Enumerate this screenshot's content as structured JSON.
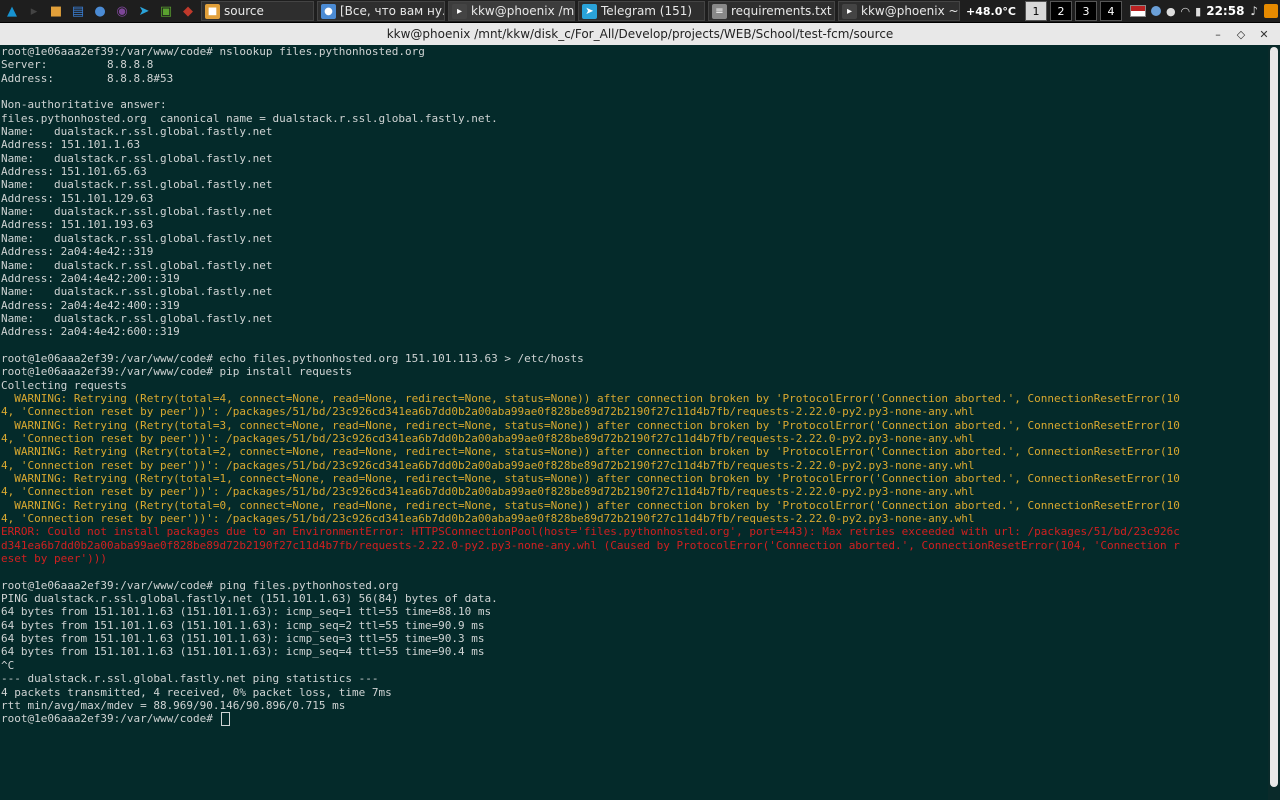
{
  "panel": {
    "launchers": [
      {
        "icon": "arch-logo-icon",
        "color": "#1793d1"
      },
      {
        "icon": "terminal-icon",
        "color": "#444"
      },
      {
        "icon": "folder-icon",
        "color": "#e2a03a"
      },
      {
        "icon": "files-icon",
        "color": "#3a7fd5"
      },
      {
        "icon": "chromium-icon",
        "color": "#4b8bd4"
      },
      {
        "icon": "tor-icon",
        "color": "#7d4698"
      },
      {
        "icon": "telegram-icon",
        "color": "#2aa3d9"
      },
      {
        "icon": "screenshot-icon",
        "color": "#5aa12f"
      },
      {
        "icon": "app-icon",
        "color": "#c0392b"
      }
    ],
    "tasks": [
      {
        "label": "source",
        "icon": "folder-icon",
        "color": "#e2a03a"
      },
      {
        "label": "[Все, что вам ну...",
        "icon": "chromium-icon",
        "color": "#4b8bd4"
      },
      {
        "label": "kkw@phoenix /m...",
        "icon": "terminal-icon",
        "color": "#444",
        "active": true
      },
      {
        "label": "Telegram (151)",
        "icon": "telegram-icon",
        "color": "#2aa3d9"
      },
      {
        "label": "requirements.txt ...",
        "icon": "text-editor-icon",
        "color": "#888"
      },
      {
        "label": "kkw@phoenix ~",
        "icon": "terminal-icon",
        "color": "#444"
      }
    ],
    "temperature": "+48.0°C",
    "workspaces": [
      "1",
      "2",
      "3",
      "4"
    ],
    "current_workspace": "1",
    "tray_icons": [
      "us-flag-icon",
      "chromium-tray-icon",
      "user-icon",
      "wifi-icon",
      "battery-icon"
    ],
    "clock": "22:58",
    "extra_icons": [
      "music-icon",
      "app-menu-icon"
    ]
  },
  "window": {
    "title": "kkw@phoenix /mnt/kkw/disk_c/For_All/Develop/projects/WEB/School/test-fcm/source",
    "buttons": {
      "minimize": "–",
      "maximize": "◇",
      "close": "✕"
    }
  },
  "terminal": {
    "lines": [
      {
        "t": "root@1e06aaa2ef39:/var/www/code# nslookup files.pythonhosted.org",
        "c": "n"
      },
      {
        "t": "Server:         8.8.8.8",
        "c": "n"
      },
      {
        "t": "Address:        8.8.8.8#53",
        "c": "n"
      },
      {
        "t": "",
        "c": "n"
      },
      {
        "t": "Non-authoritative answer:",
        "c": "n"
      },
      {
        "t": "files.pythonhosted.org  canonical name = dualstack.r.ssl.global.fastly.net.",
        "c": "n"
      },
      {
        "t": "Name:   dualstack.r.ssl.global.fastly.net",
        "c": "n"
      },
      {
        "t": "Address: 151.101.1.63",
        "c": "n"
      },
      {
        "t": "Name:   dualstack.r.ssl.global.fastly.net",
        "c": "n"
      },
      {
        "t": "Address: 151.101.65.63",
        "c": "n"
      },
      {
        "t": "Name:   dualstack.r.ssl.global.fastly.net",
        "c": "n"
      },
      {
        "t": "Address: 151.101.129.63",
        "c": "n"
      },
      {
        "t": "Name:   dualstack.r.ssl.global.fastly.net",
        "c": "n"
      },
      {
        "t": "Address: 151.101.193.63",
        "c": "n"
      },
      {
        "t": "Name:   dualstack.r.ssl.global.fastly.net",
        "c": "n"
      },
      {
        "t": "Address: 2a04:4e42::319",
        "c": "n"
      },
      {
        "t": "Name:   dualstack.r.ssl.global.fastly.net",
        "c": "n"
      },
      {
        "t": "Address: 2a04:4e42:200::319",
        "c": "n"
      },
      {
        "t": "Name:   dualstack.r.ssl.global.fastly.net",
        "c": "n"
      },
      {
        "t": "Address: 2a04:4e42:400::319",
        "c": "n"
      },
      {
        "t": "Name:   dualstack.r.ssl.global.fastly.net",
        "c": "n"
      },
      {
        "t": "Address: 2a04:4e42:600::319",
        "c": "n"
      },
      {
        "t": "",
        "c": "n"
      },
      {
        "t": "root@1e06aaa2ef39:/var/www/code# echo files.pythonhosted.org 151.101.113.63 > /etc/hosts",
        "c": "n"
      },
      {
        "t": "root@1e06aaa2ef39:/var/www/code# pip install requests",
        "c": "n"
      },
      {
        "t": "Collecting requests",
        "c": "n"
      },
      {
        "t": "  WARNING: Retrying (Retry(total=4, connect=None, read=None, redirect=None, status=None)) after connection broken by 'ProtocolError('Connection aborted.', ConnectionResetError(10",
        "c": "w"
      },
      {
        "t": "4, 'Connection reset by peer'))': /packages/51/bd/23c926cd341ea6b7dd0b2a00aba99ae0f828be89d72b2190f27c11d4b7fb/requests-2.22.0-py2.py3-none-any.whl",
        "c": "w"
      },
      {
        "t": "  WARNING: Retrying (Retry(total=3, connect=None, read=None, redirect=None, status=None)) after connection broken by 'ProtocolError('Connection aborted.', ConnectionResetError(10",
        "c": "w"
      },
      {
        "t": "4, 'Connection reset by peer'))': /packages/51/bd/23c926cd341ea6b7dd0b2a00aba99ae0f828be89d72b2190f27c11d4b7fb/requests-2.22.0-py2.py3-none-any.whl",
        "c": "w"
      },
      {
        "t": "  WARNING: Retrying (Retry(total=2, connect=None, read=None, redirect=None, status=None)) after connection broken by 'ProtocolError('Connection aborted.', ConnectionResetError(10",
        "c": "w"
      },
      {
        "t": "4, 'Connection reset by peer'))': /packages/51/bd/23c926cd341ea6b7dd0b2a00aba99ae0f828be89d72b2190f27c11d4b7fb/requests-2.22.0-py2.py3-none-any.whl",
        "c": "w"
      },
      {
        "t": "  WARNING: Retrying (Retry(total=1, connect=None, read=None, redirect=None, status=None)) after connection broken by 'ProtocolError('Connection aborted.', ConnectionResetError(10",
        "c": "w"
      },
      {
        "t": "4, 'Connection reset by peer'))': /packages/51/bd/23c926cd341ea6b7dd0b2a00aba99ae0f828be89d72b2190f27c11d4b7fb/requests-2.22.0-py2.py3-none-any.whl",
        "c": "w"
      },
      {
        "t": "  WARNING: Retrying (Retry(total=0, connect=None, read=None, redirect=None, status=None)) after connection broken by 'ProtocolError('Connection aborted.', ConnectionResetError(10",
        "c": "w"
      },
      {
        "t": "4, 'Connection reset by peer'))': /packages/51/bd/23c926cd341ea6b7dd0b2a00aba99ae0f828be89d72b2190f27c11d4b7fb/requests-2.22.0-py2.py3-none-any.whl",
        "c": "w"
      },
      {
        "t": "ERROR: Could not install packages due to an EnvironmentError: HTTPSConnectionPool(host='files.pythonhosted.org', port=443): Max retries exceeded with url: /packages/51/bd/23c926c",
        "c": "e"
      },
      {
        "t": "d341ea6b7dd0b2a00aba99ae0f828be89d72b2190f27c11d4b7fb/requests-2.22.0-py2.py3-none-any.whl (Caused by ProtocolError('Connection aborted.', ConnectionResetError(104, 'Connection r",
        "c": "e"
      },
      {
        "t": "eset by peer')))",
        "c": "e"
      },
      {
        "t": "",
        "c": "n"
      },
      {
        "t": "root@1e06aaa2ef39:/var/www/code# ping files.pythonhosted.org",
        "c": "n"
      },
      {
        "t": "PING dualstack.r.ssl.global.fastly.net (151.101.1.63) 56(84) bytes of data.",
        "c": "n"
      },
      {
        "t": "64 bytes from 151.101.1.63 (151.101.1.63): icmp_seq=1 ttl=55 time=88.10 ms",
        "c": "n"
      },
      {
        "t": "64 bytes from 151.101.1.63 (151.101.1.63): icmp_seq=2 ttl=55 time=90.9 ms",
        "c": "n"
      },
      {
        "t": "64 bytes from 151.101.1.63 (151.101.1.63): icmp_seq=3 ttl=55 time=90.3 ms",
        "c": "n"
      },
      {
        "t": "64 bytes from 151.101.1.63 (151.101.1.63): icmp_seq=4 ttl=55 time=90.4 ms",
        "c": "n"
      },
      {
        "t": "^C",
        "c": "n"
      },
      {
        "t": "--- dualstack.r.ssl.global.fastly.net ping statistics ---",
        "c": "n"
      },
      {
        "t": "4 packets transmitted, 4 received, 0% packet loss, time 7ms",
        "c": "n"
      },
      {
        "t": "rtt min/avg/max/mdev = 88.969/90.146/90.896/0.715 ms",
        "c": "n"
      }
    ],
    "prompt": "root@1e06aaa2ef39:/var/www/code# ",
    "colors": {
      "background": "#042a2a",
      "text": "#cfd3d3",
      "warning": "#d8a830",
      "error": "#d02020"
    }
  }
}
